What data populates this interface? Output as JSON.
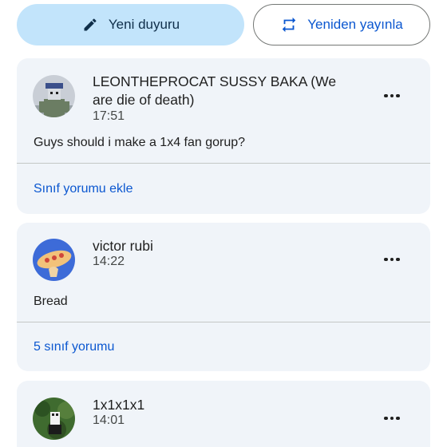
{
  "actions": {
    "new_announcement": "Yeni duyuru",
    "repost": "Yeniden yayınla"
  },
  "posts": [
    {
      "author": "LEONTHEPROCAT SUSSY BAKA (We are die of death)",
      "time": "17:51",
      "text": "Guys should i make a 1x4 fan gorup?",
      "comment_link": "Sınıf yorumu ekle"
    },
    {
      "author": "victor rubi",
      "time": "14:22",
      "text": "Bread",
      "comment_link": "5 sınıf yorumu"
    },
    {
      "author": "1x1x1x1",
      "time": "14:01"
    }
  ],
  "colors": {
    "accent": "#0b57d0",
    "primary_button": "#c2e4fb",
    "card_bg": "#f0f4f9"
  }
}
